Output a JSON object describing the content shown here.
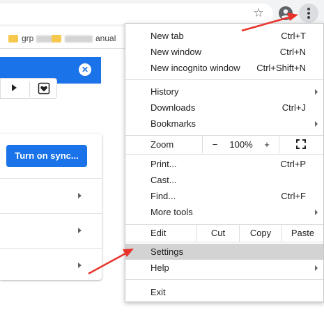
{
  "toolbar": {
    "icons": [
      "star-icon",
      "profile-icon",
      "kebab-menu-icon"
    ]
  },
  "bookmarks": {
    "item1": "grp",
    "item2": "anual"
  },
  "media": {
    "icons": [
      "play-icon",
      "heart-icon"
    ]
  },
  "settings_card": {
    "sync_button": "Turn on sync..."
  },
  "menu": {
    "new_tab": {
      "label": "New tab",
      "shortcut": "Ctrl+T"
    },
    "new_window": {
      "label": "New window",
      "shortcut": "Ctrl+N"
    },
    "new_incognito": {
      "label": "New incognito window",
      "shortcut": "Ctrl+Shift+N"
    },
    "history": {
      "label": "History"
    },
    "downloads": {
      "label": "Downloads",
      "shortcut": "Ctrl+J"
    },
    "bookmarks": {
      "label": "Bookmarks"
    },
    "zoom": {
      "label": "Zoom",
      "minus": "−",
      "value": "100%",
      "plus": "+"
    },
    "print": {
      "label": "Print...",
      "shortcut": "Ctrl+P"
    },
    "cast": {
      "label": "Cast..."
    },
    "find": {
      "label": "Find...",
      "shortcut": "Ctrl+F"
    },
    "more_tools": {
      "label": "More tools"
    },
    "edit": {
      "label": "Edit",
      "cut": "Cut",
      "copy": "Copy",
      "paste": "Paste"
    },
    "settings": {
      "label": "Settings"
    },
    "help": {
      "label": "Help"
    },
    "exit": {
      "label": "Exit"
    }
  },
  "colors": {
    "accent": "#1a73e8",
    "annotation_arrow": "#e8322b",
    "highlight": "#d3d3d3"
  }
}
